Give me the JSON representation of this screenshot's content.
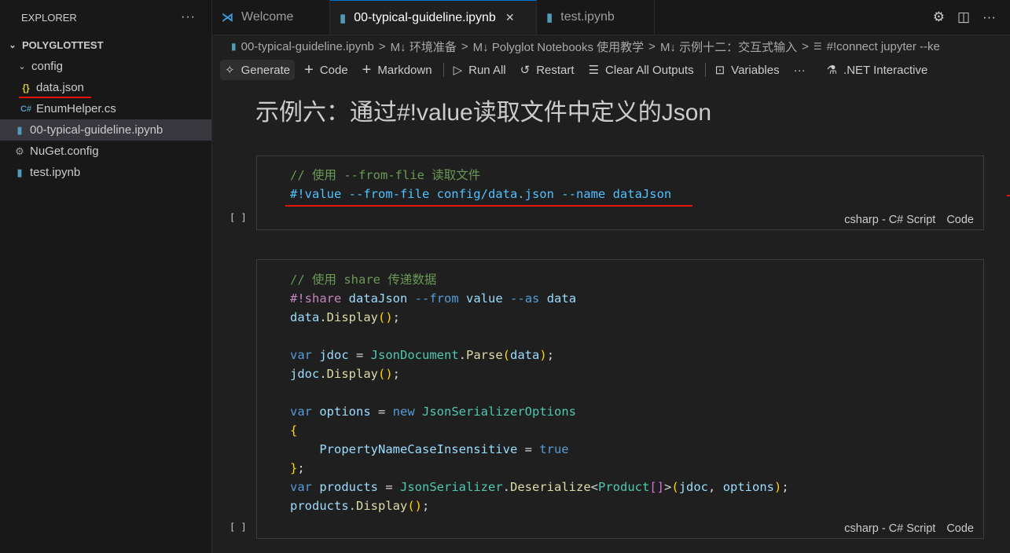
{
  "sidebar": {
    "title": "EXPLORER",
    "more": "···",
    "section": "POLYGLOTTEST",
    "items": [
      {
        "label": "config",
        "icon": "chevron-down-icon"
      },
      {
        "label": "data.json",
        "icon": "json-braces-icon"
      },
      {
        "label": "EnumHelper.cs",
        "icon": "csharp-icon"
      },
      {
        "label": "00-typical-guideline.ipynb",
        "icon": "notebook-icon"
      },
      {
        "label": "NuGet.config",
        "icon": "gear-icon"
      },
      {
        "label": "test.ipynb",
        "icon": "notebook-icon"
      }
    ]
  },
  "tabs": [
    {
      "label": "Welcome",
      "icon": "vscode-logo-icon"
    },
    {
      "label": "00-typical-guideline.ipynb",
      "icon": "notebook-icon",
      "close": "✕"
    },
    {
      "label": "test.ipynb",
      "icon": "notebook-icon"
    }
  ],
  "breadcrumb": [
    "00-typical-guideline.ipynb",
    "M↓ 环境准备",
    "M↓ Polyglot Notebooks 使用教学",
    "M↓ 示例十二：交互式输入",
    "#!connect jupyter --ke"
  ],
  "toolbar": {
    "generate": "Generate",
    "code": "Code",
    "markdown": "Markdown",
    "run_all": "Run All",
    "restart": "Restart",
    "clear_outputs": "Clear All Outputs",
    "variables": "Variables",
    "more": "···",
    "kernel": ".NET Interactive"
  },
  "editor": {
    "heading": "示例六：通过#!value读取文件中定义的Json",
    "cell1": {
      "exec": "[ ]",
      "line1": "// 使用 --from-flie 读取文件",
      "line2": "#!value --from-file config/data.json --name dataJson",
      "lang": "csharp - C# Script",
      "kind": "Code"
    },
    "cell2": {
      "exec": "[ ]",
      "lang": "csharp - C# Script",
      "kind": "Code",
      "comment": "// 使用 share 传递数据"
    }
  },
  "colors": {
    "accent": "#0078d4",
    "highlight_red": "#e51400"
  }
}
